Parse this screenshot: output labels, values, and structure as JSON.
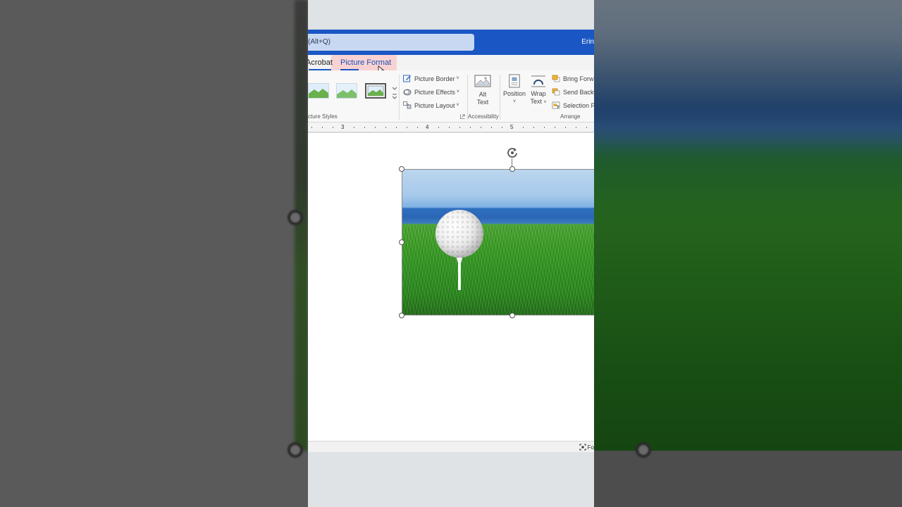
{
  "titlebar": {
    "search_text": "(Alt+Q)",
    "user_name": "Erin"
  },
  "tabs": [
    {
      "label": "Acrobat"
    },
    {
      "label": "Picture Format",
      "active": true
    }
  ],
  "ribbon": {
    "picture_styles_label": "cture Styles",
    "style_commands": [
      {
        "label": "Picture Border",
        "icon": "pen-border-icon"
      },
      {
        "label": "Picture Effects",
        "icon": "effects-icon"
      },
      {
        "label": "Picture Layout",
        "icon": "layout-icon"
      }
    ],
    "alt_text": {
      "line1": "Alt",
      "line2": "Text"
    },
    "accessibility_label": "Accessibility",
    "position_label": "Position",
    "wrap_text": {
      "line1": "Wrap",
      "line2": "Text"
    },
    "arrange_commands": [
      {
        "label": "Bring Forwa",
        "icon": "bring-forward-icon"
      },
      {
        "label": "Send Backw",
        "icon": "send-backward-icon"
      },
      {
        "label": "Selection Pa",
        "icon": "selection-pane-icon"
      }
    ],
    "arrange_label": "Arrange"
  },
  "ruler": {
    "marks": [
      "3",
      "4",
      "5"
    ]
  },
  "document": {
    "image_subject": "golf ball on tee on grass"
  },
  "statusbar": {
    "focus_label": "Fo"
  },
  "colors": {
    "titlebar_blue": "#1a56c4",
    "tab_active_text": "#1a4fb8",
    "tab_highlight": "#ffaaaa"
  }
}
